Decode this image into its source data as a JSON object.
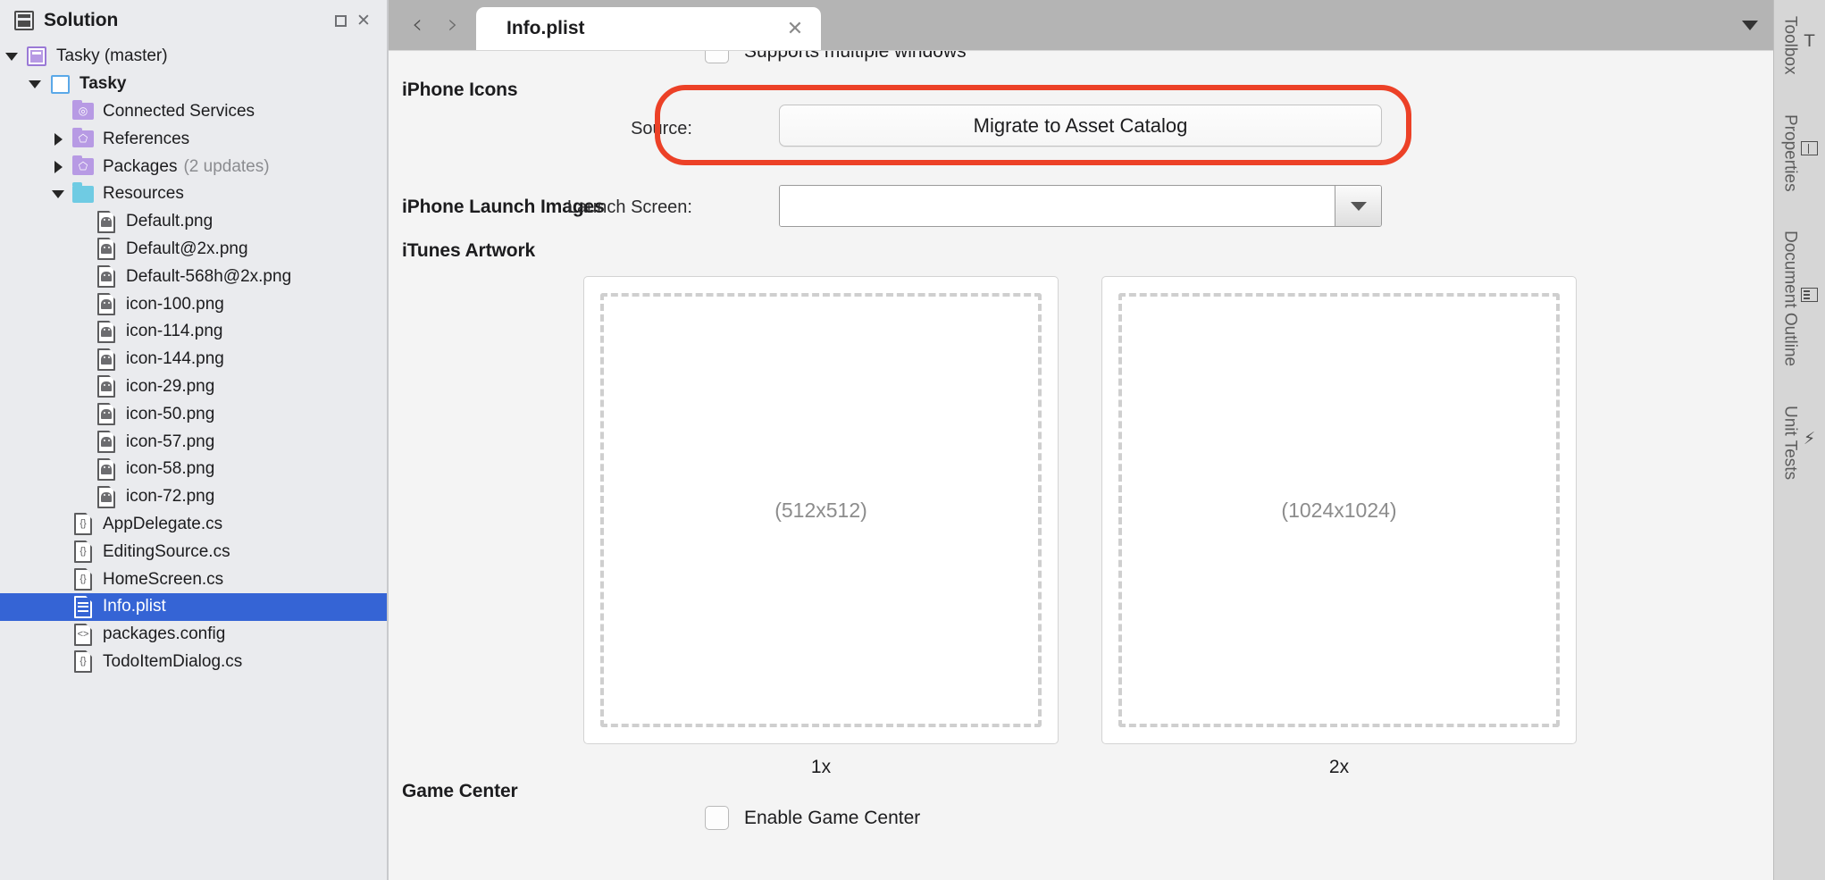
{
  "solution_pad": {
    "title": "Solution",
    "header_icon": "solution-icon",
    "minimize_label": "▫",
    "close_label": "✕",
    "tree": [
      {
        "label": "Tasky (master)",
        "icon": "solution-icon",
        "indent": 0,
        "twisty": "down",
        "bold": false,
        "sub": "",
        "selected": false
      },
      {
        "label": "Tasky",
        "icon": "project-icon",
        "indent": 1,
        "twisty": "down",
        "bold": true,
        "sub": "",
        "selected": false
      },
      {
        "label": "Connected Services",
        "icon": "folder-share-icon",
        "indent": 2,
        "twisty": "none",
        "bold": false,
        "sub": "",
        "selected": false
      },
      {
        "label": "References",
        "icon": "folder-package-icon",
        "indent": 2,
        "twisty": "right",
        "bold": false,
        "sub": "",
        "selected": false
      },
      {
        "label": "Packages",
        "icon": "folder-package-icon",
        "indent": 2,
        "twisty": "right",
        "bold": false,
        "sub": "(2 updates)",
        "selected": false
      },
      {
        "label": "Resources",
        "icon": "folder-blue-icon",
        "indent": 2,
        "twisty": "down",
        "bold": false,
        "sub": "",
        "selected": false
      },
      {
        "label": "Default.png",
        "icon": "image-file-icon",
        "indent": 3,
        "twisty": "none",
        "bold": false,
        "sub": "",
        "selected": false
      },
      {
        "label": "Default@2x.png",
        "icon": "image-file-icon",
        "indent": 3,
        "twisty": "none",
        "bold": false,
        "sub": "",
        "selected": false
      },
      {
        "label": "Default-568h@2x.png",
        "icon": "image-file-icon",
        "indent": 3,
        "twisty": "none",
        "bold": false,
        "sub": "",
        "selected": false
      },
      {
        "label": "icon-100.png",
        "icon": "image-file-icon",
        "indent": 3,
        "twisty": "none",
        "bold": false,
        "sub": "",
        "selected": false
      },
      {
        "label": "icon-114.png",
        "icon": "image-file-icon",
        "indent": 3,
        "twisty": "none",
        "bold": false,
        "sub": "",
        "selected": false
      },
      {
        "label": "icon-144.png",
        "icon": "image-file-icon",
        "indent": 3,
        "twisty": "none",
        "bold": false,
        "sub": "",
        "selected": false
      },
      {
        "label": "icon-29.png",
        "icon": "image-file-icon",
        "indent": 3,
        "twisty": "none",
        "bold": false,
        "sub": "",
        "selected": false
      },
      {
        "label": "icon-50.png",
        "icon": "image-file-icon",
        "indent": 3,
        "twisty": "none",
        "bold": false,
        "sub": "",
        "selected": false
      },
      {
        "label": "icon-57.png",
        "icon": "image-file-icon",
        "indent": 3,
        "twisty": "none",
        "bold": false,
        "sub": "",
        "selected": false
      },
      {
        "label": "icon-58.png",
        "icon": "image-file-icon",
        "indent": 3,
        "twisty": "none",
        "bold": false,
        "sub": "",
        "selected": false
      },
      {
        "label": "icon-72.png",
        "icon": "image-file-icon",
        "indent": 3,
        "twisty": "none",
        "bold": false,
        "sub": "",
        "selected": false
      },
      {
        "label": "AppDelegate.cs",
        "icon": "csharp-file-icon",
        "indent": 2,
        "twisty": "none",
        "bold": false,
        "sub": "",
        "selected": false
      },
      {
        "label": "EditingSource.cs",
        "icon": "csharp-file-icon",
        "indent": 2,
        "twisty": "none",
        "bold": false,
        "sub": "",
        "selected": false
      },
      {
        "label": "HomeScreen.cs",
        "icon": "csharp-file-icon",
        "indent": 2,
        "twisty": "none",
        "bold": false,
        "sub": "",
        "selected": false
      },
      {
        "label": "Info.plist",
        "icon": "plist-file-icon",
        "indent": 2,
        "twisty": "none",
        "bold": false,
        "sub": "",
        "selected": true
      },
      {
        "label": "packages.config",
        "icon": "xml-file-icon",
        "indent": 2,
        "twisty": "none",
        "bold": false,
        "sub": "",
        "selected": false
      },
      {
        "label": "TodoItemDialog.cs",
        "icon": "csharp-file-icon",
        "indent": 2,
        "twisty": "none",
        "bold": false,
        "sub": "",
        "selected": false
      }
    ]
  },
  "tabstrip": {
    "back_label": "‹",
    "forward_label": "›",
    "overflow_label": "▾",
    "active_tab": {
      "title": "Info.plist",
      "close_label": "✕"
    }
  },
  "content": {
    "cutoff_checkbox_label": "Supports multiple windows",
    "sections": {
      "iphone_icons": {
        "heading": "iPhone Icons",
        "source_label": "Source:",
        "source_button": "Migrate to Asset Catalog"
      },
      "iphone_launch_images": {
        "heading": "iPhone Launch Images",
        "launch_screen_label": "Launch Screen:",
        "launch_screen_value": ""
      },
      "itunes_artwork": {
        "heading": "iTunes Artwork",
        "slots": [
          {
            "placeholder": "(512x512)",
            "caption": "1x"
          },
          {
            "placeholder": "(1024x1024)",
            "caption": "2x"
          }
        ]
      },
      "game_center": {
        "heading": "Game Center",
        "enable_label": "Enable Game Center",
        "enable_checked": false
      }
    },
    "annotation_color": "#ec4127"
  },
  "right_rail": {
    "items": [
      {
        "label": "Toolbox",
        "icon": "toolbox-icon"
      },
      {
        "label": "Properties",
        "icon": "properties-icon"
      },
      {
        "label": "Document Outline",
        "icon": "document-outline-icon"
      },
      {
        "label": "Unit Tests",
        "icon": "unit-tests-icon"
      }
    ]
  }
}
